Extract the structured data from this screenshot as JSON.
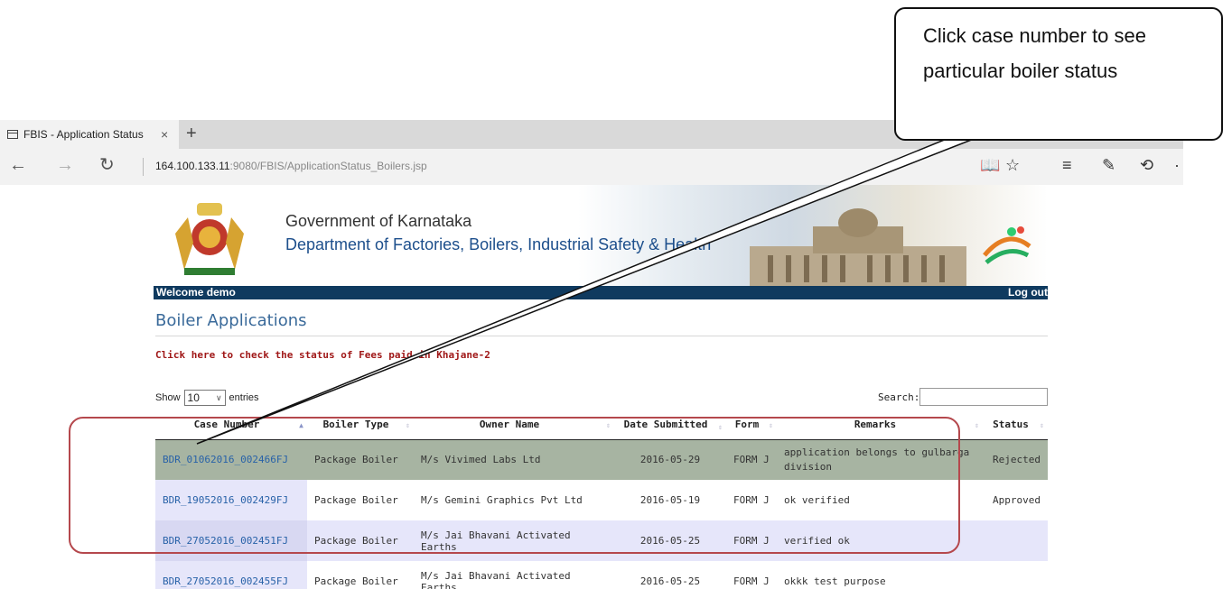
{
  "browser": {
    "tab_title": "FBIS - Application Status",
    "close_glyph": "×",
    "new_tab_glyph": "+",
    "url_host": "164.100.133.11",
    "url_path": ":9080/FBIS/ApplicationStatus_Boilers.jsp",
    "icons": [
      "back-icon",
      "forward-icon",
      "refresh-icon",
      "reading-view-icon",
      "favorite-star-icon",
      "hub-icon",
      "web-note-icon",
      "share-icon",
      "more-icon"
    ]
  },
  "header": {
    "gov_title": "Government of Karnataka",
    "dept_title": "Department of Factories, Boilers, Industrial Safety & Health",
    "welcome": "Welcome demo",
    "logout": "Log out"
  },
  "main": {
    "heading": "Boiler Applications",
    "fees_link": "Click here to check the status of Fees paid in Khajane-2",
    "show_label": "Show",
    "entries_value": "10",
    "entries_label": "entries",
    "search_label": "Search:",
    "search_value": ""
  },
  "table": {
    "columns": [
      "Case Number",
      "Boiler Type",
      "Owner Name",
      "Date Submitted",
      "Form",
      "Remarks",
      "Status"
    ],
    "rows": [
      {
        "case": "BDR_01062016_002466FJ",
        "type": "Package Boiler",
        "owner": "M/s Vivimed Labs Ltd",
        "date": "2016-05-29",
        "form": "FORM J",
        "remarks": "application belongs to gulbarga division",
        "status": "Rejected"
      },
      {
        "case": "BDR_19052016_002429FJ",
        "type": "Package Boiler",
        "owner": "M/s Gemini Graphics Pvt Ltd",
        "date": "2016-05-19",
        "form": "FORM J",
        "remarks": "ok verified",
        "status": "Approved"
      },
      {
        "case": "BDR_27052016_002451FJ",
        "type": "Package Boiler",
        "owner": "M/s Jai Bhavani Activated Earths",
        "date": "2016-05-25",
        "form": "FORM J",
        "remarks": "verified ok",
        "status": ""
      },
      {
        "case": "BDR_27052016_002455FJ",
        "type": "Package Boiler",
        "owner": "M/s Jai Bhavani Activated Earths",
        "date": "2016-05-25",
        "form": "FORM J",
        "remarks": "okkk test purpose",
        "status": ""
      }
    ]
  },
  "annotation": {
    "callout_text": "Click case number to see particular boiler status",
    "highlight_color": "#b5484d"
  },
  "colors": {
    "selected_row": "#a7b4a2",
    "alt_row": "#e6e6fa",
    "link": "#2862a8",
    "header_bar": "#0f3a5f",
    "fees_link": "#a01818"
  }
}
